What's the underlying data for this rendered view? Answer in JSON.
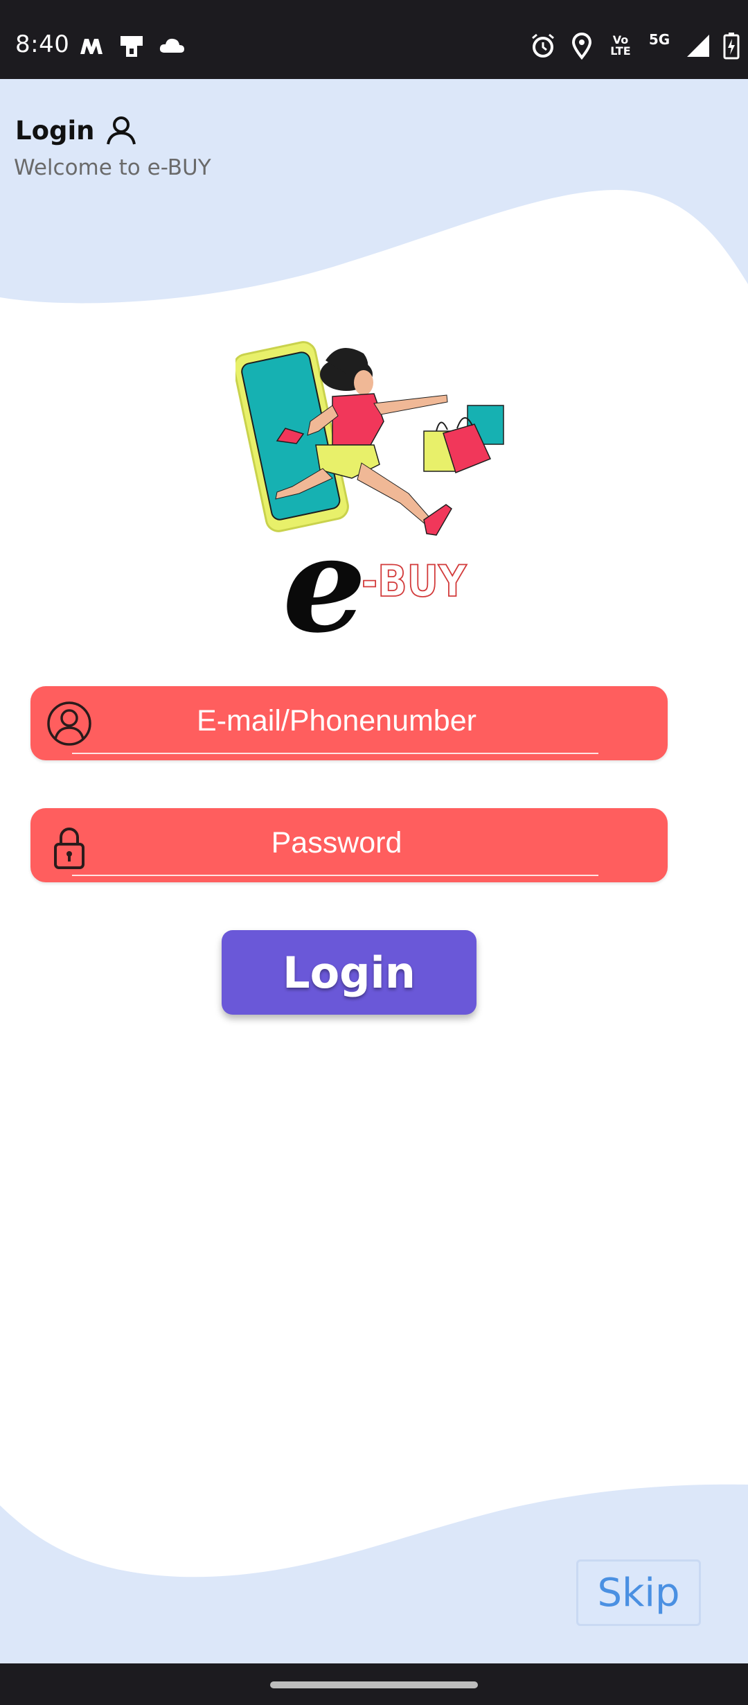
{
  "status_bar": {
    "time": "8:40",
    "left_icons": [
      "m-app-icon",
      "device-icon",
      "cloud-icon"
    ],
    "right_icons": [
      "alarm-icon",
      "location-icon",
      "volte-icon",
      "5g-icon",
      "signal-icon",
      "battery-charging-icon"
    ],
    "volte_top": "Vo",
    "volte_bottom": "LTE",
    "network": "5G"
  },
  "header": {
    "title": "Login",
    "subtitle": "Welcome to e-BUY"
  },
  "logo": {
    "letter": "e",
    "wordmark": "-BUY"
  },
  "form": {
    "email_placeholder": "E-mail/Phonenumber",
    "password_placeholder": "Password",
    "login_label": "Login"
  },
  "skip_label": "Skip",
  "colors": {
    "wave": "#dce7f9",
    "field": "#ff5e5e",
    "button": "#6a58d8",
    "skip_text": "#4a90e2"
  }
}
